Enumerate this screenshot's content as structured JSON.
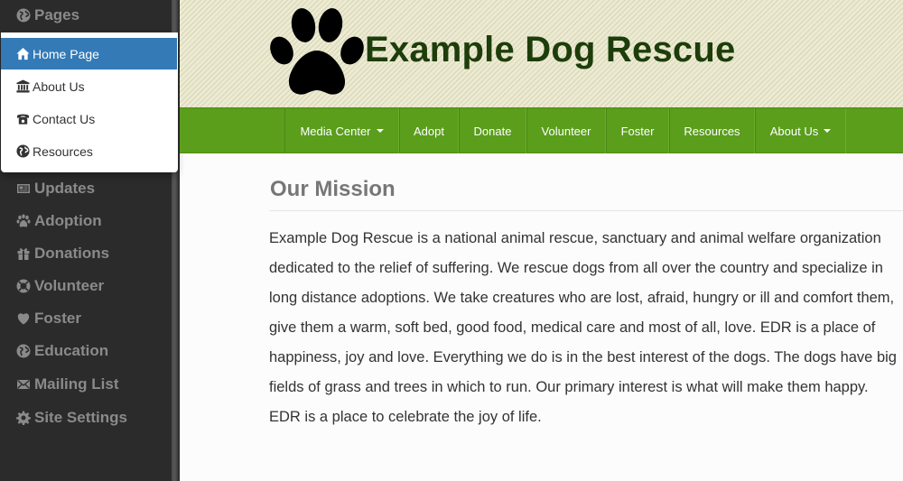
{
  "sidebar": {
    "pages_label": "Pages",
    "items": [
      {
        "label": "Updates",
        "icon": "newspaper-icon"
      },
      {
        "label": "Adoption",
        "icon": "paw-icon"
      },
      {
        "label": "Donations",
        "icon": "gift-icon"
      },
      {
        "label": "Volunteer",
        "icon": "life-ring-icon"
      },
      {
        "label": "Foster",
        "icon": "heart-icon"
      },
      {
        "label": "Education",
        "icon": "globe-icon"
      },
      {
        "label": "Mailing List",
        "icon": "envelope-icon"
      },
      {
        "label": "Site Settings",
        "icon": "gear-icon"
      }
    ]
  },
  "dropdown": {
    "items": [
      {
        "label": "Home Page",
        "icon": "home-icon",
        "active": true
      },
      {
        "label": "About Us",
        "icon": "bank-icon"
      },
      {
        "label": "Contact Us",
        "icon": "phone-icon"
      },
      {
        "label": "Resources",
        "icon": "globe-icon"
      }
    ]
  },
  "header": {
    "title": "Example Dog Rescue"
  },
  "nav": [
    {
      "label": "Media Center",
      "dropdown": true
    },
    {
      "label": "Adopt"
    },
    {
      "label": "Donate"
    },
    {
      "label": "Volunteer"
    },
    {
      "label": "Foster"
    },
    {
      "label": "Resources"
    },
    {
      "label": "About Us",
      "dropdown": true
    }
  ],
  "content": {
    "heading": "Our Mission",
    "body": "Example Dog Rescue is a national animal rescue, sanctuary and animal welfare organization dedicated to the relief of suffering. We rescue dogs from all over the country and specialize in long distance adoptions. We take creatures who are lost, afraid, hungry or ill and comfort them, give them a warm, soft bed, good food, medical care and most of all, love. EDR is a place of happiness, joy and love. Everything we do is in the best interest of the dogs. The dogs have big fields of grass and trees in which to run. Our primary interest is what will make them happy. EDR is a place to celebrate the joy of life."
  },
  "colors": {
    "sidebar_bg": "#2b2b2b",
    "sidebar_text": "#8a8a8a",
    "active_blue": "#337ab7",
    "nav_green": "#5a9e1c",
    "title_green": "#1d3d0a"
  }
}
